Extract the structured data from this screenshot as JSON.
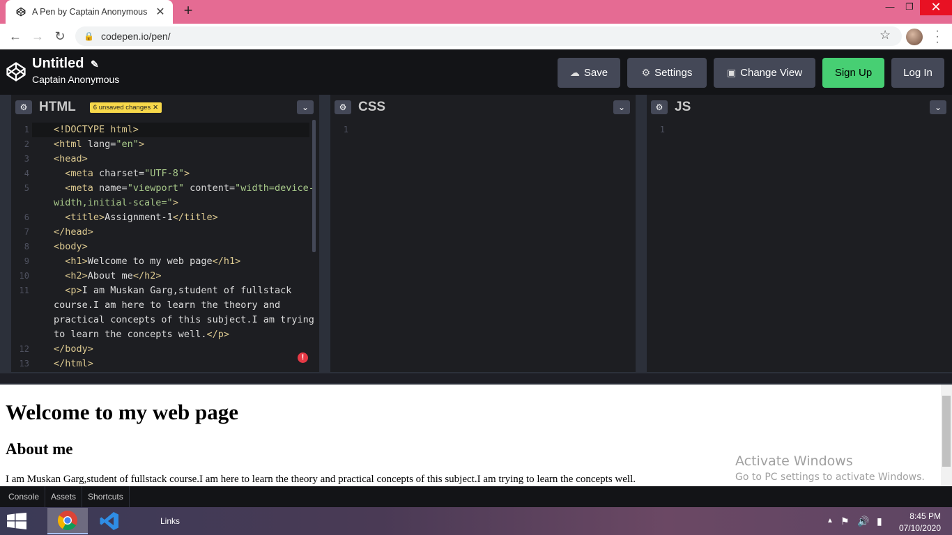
{
  "browser": {
    "tab_title": "A Pen by Captain Anonymous",
    "tab_close": "✕",
    "new_tab": "+",
    "url": "codepen.io/pen/",
    "win_min": "—",
    "win_max": "❐",
    "win_close": "✕"
  },
  "header": {
    "title": "Untitled",
    "owner": "Captain Anonymous",
    "save": "Save",
    "settings": "Settings",
    "change_view": "Change View",
    "sign_up": "Sign Up",
    "log_in": "Log In"
  },
  "panes": {
    "html": {
      "name": "HTML",
      "badge": "6 unsaved changes"
    },
    "css": {
      "name": "CSS",
      "line1": "1"
    },
    "js": {
      "name": "JS",
      "line1": "1"
    }
  },
  "html_code": [
    {
      "n": "1",
      "parts": [
        [
          "tag",
          "<!DOCTYPE html>"
        ]
      ]
    },
    {
      "n": "2",
      "parts": [
        [
          "tag",
          "<html "
        ],
        [
          "attr",
          "lang="
        ],
        [
          "str",
          "\"en\""
        ],
        [
          "tag",
          ">"
        ]
      ]
    },
    {
      "n": "3",
      "parts": [
        [
          "tag",
          "<head>"
        ]
      ]
    },
    {
      "n": "4",
      "parts": [
        [
          "txt",
          "  "
        ],
        [
          "tag",
          "<meta "
        ],
        [
          "attr",
          "charset="
        ],
        [
          "str",
          "\"UTF-8\""
        ],
        [
          "tag",
          ">"
        ]
      ]
    },
    {
      "n": "5",
      "parts": [
        [
          "txt",
          "  "
        ],
        [
          "tag",
          "<meta "
        ],
        [
          "attr",
          "name="
        ],
        [
          "str",
          "\"viewport\""
        ],
        [
          "attr",
          " content="
        ],
        [
          "str",
          "\"width=device-"
        ]
      ]
    },
    {
      "n": "",
      "parts": [
        [
          "str",
          "width,initial-scale=\""
        ],
        [
          "tag",
          ">"
        ]
      ]
    },
    {
      "n": "6",
      "parts": [
        [
          "txt",
          "  "
        ],
        [
          "tag",
          "<title>"
        ],
        [
          "txt",
          "Assignment-1"
        ],
        [
          "tag",
          "</title>"
        ]
      ]
    },
    {
      "n": "7",
      "parts": [
        [
          "tag",
          "</head>"
        ]
      ]
    },
    {
      "n": "8",
      "parts": [
        [
          "tag",
          "<body>"
        ]
      ]
    },
    {
      "n": "9",
      "parts": [
        [
          "txt",
          "  "
        ],
        [
          "tag",
          "<h1>"
        ],
        [
          "txt",
          "Welcome to my web page"
        ],
        [
          "tag",
          "</h1>"
        ]
      ]
    },
    {
      "n": "10",
      "parts": [
        [
          "txt",
          "  "
        ],
        [
          "tag",
          "<h2>"
        ],
        [
          "txt",
          "About me"
        ],
        [
          "tag",
          "</h2>"
        ]
      ]
    },
    {
      "n": "11",
      "parts": [
        [
          "txt",
          "  "
        ],
        [
          "tag",
          "<p>"
        ],
        [
          "txt",
          "I am Muskan Garg,student of fullstack"
        ]
      ]
    },
    {
      "n": "",
      "parts": [
        [
          "txt",
          "course.I am here to learn the theory and"
        ]
      ]
    },
    {
      "n": "",
      "parts": [
        [
          "txt",
          "practical concepts of this subject.I am trying"
        ]
      ]
    },
    {
      "n": "",
      "parts": [
        [
          "txt",
          "to learn the concepts well."
        ],
        [
          "tag",
          "</p>"
        ]
      ]
    },
    {
      "n": "12",
      "parts": [
        [
          "tag",
          "</body>"
        ]
      ]
    },
    {
      "n": "13",
      "parts": [
        [
          "tag",
          "</html>"
        ]
      ]
    }
  ],
  "preview": {
    "h1": "Welcome to my web page",
    "h2": "About me",
    "p": "I am Muskan Garg,student of fullstack course.I am here to learn the theory and practical concepts of this subject.I am trying to learn the concepts well."
  },
  "watermark": {
    "line1": "Activate Windows",
    "line2": "Go to PC settings to activate Windows."
  },
  "footer": {
    "console": "Console",
    "assets": "Assets",
    "shortcuts": "Shortcuts"
  },
  "taskbar": {
    "links": "Links",
    "time": "8:45 PM",
    "date": "07/10/2020"
  }
}
